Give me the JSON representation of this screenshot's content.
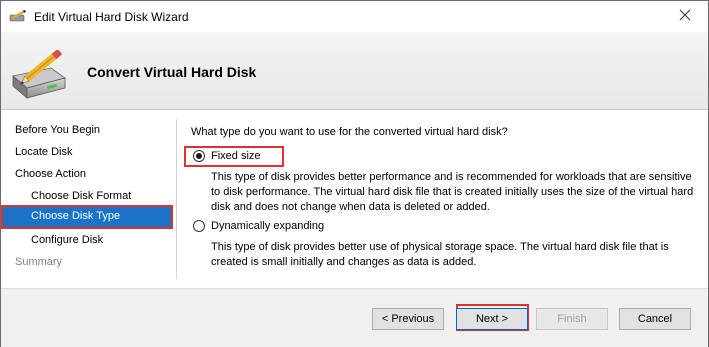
{
  "window": {
    "title": "Edit Virtual Hard Disk Wizard"
  },
  "header": {
    "title": "Convert Virtual Hard Disk"
  },
  "nav": {
    "items": [
      {
        "label": "Before You Begin"
      },
      {
        "label": "Locate Disk"
      },
      {
        "label": "Choose Action"
      },
      {
        "label": "Choose Disk Format"
      },
      {
        "label": "Choose Disk Type"
      },
      {
        "label": "Configure Disk"
      },
      {
        "label": "Summary"
      }
    ],
    "selected": "Choose Disk Type"
  },
  "main": {
    "question": "What type do you want to use for the converted virtual hard disk?",
    "options": [
      {
        "label": "Fixed size",
        "checked": true,
        "description": "This type of disk provides better performance and is recommended for workloads that are sensitive to disk performance. The virtual hard disk file that is created initially uses the size of the virtual hard disk and does not change when data is deleted or added."
      },
      {
        "label": "Dynamically expanding",
        "checked": false,
        "description": "This type of disk provides better use of physical storage space. The virtual hard disk file that is created is small initially and changes as data is added."
      }
    ]
  },
  "footer": {
    "previous": "< Previous",
    "next": "Next >",
    "finish": "Finish",
    "cancel": "Cancel"
  },
  "colors": {
    "selection": "#1a73c8",
    "annotation": "#e03131"
  },
  "icons": {
    "title": "disk-pencil-icon",
    "header": "disk-pencil-icon",
    "close": "close-icon"
  }
}
